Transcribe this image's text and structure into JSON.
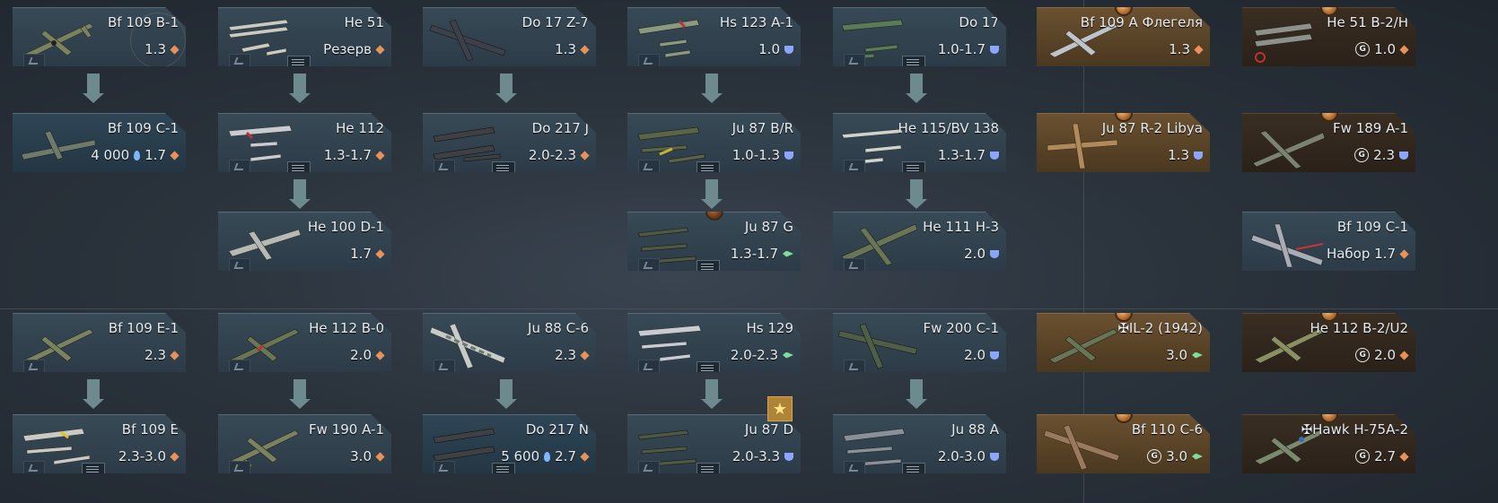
{
  "icons": {
    "fighter_color": "#e8925a",
    "bomber_color": "#8aa6ff",
    "attacker_color": "#7fdc9a"
  },
  "cards": {
    "bf109b1": {
      "name": "Bf 109 B-1",
      "br": "1.3"
    },
    "bf109c1": {
      "name": "Bf 109 C-1",
      "cost": "4 000",
      "br": "1.7"
    },
    "he51": {
      "name": "He 51",
      "br": "Резерв"
    },
    "he112": {
      "name": "He 112",
      "br": "1.3-1.7"
    },
    "he100d1": {
      "name": "He 100 D-1",
      "br": "1.7"
    },
    "do17z7": {
      "name": "Do 17 Z-7",
      "br": "1.3"
    },
    "do217j": {
      "name": "Do 217 J",
      "br": "2.0-2.3"
    },
    "hs123a1": {
      "name": "Hs 123 A-1",
      "br": "1.0"
    },
    "ju87br": {
      "name": "Ju 87 B/R",
      "br": "1.0-1.3"
    },
    "ju87g": {
      "name": "Ju 87 G",
      "br": "1.3-1.7"
    },
    "do17": {
      "name": "Do 17",
      "br": "1.0-1.7"
    },
    "he115bv138": {
      "name": "He 115/BV 138",
      "br": "1.3-1.7"
    },
    "he111h3": {
      "name": "He 111 H-3",
      "br": "2.0"
    },
    "bf109a_fleg": {
      "name": "Bf 109 A Флегеля",
      "br": "1.3"
    },
    "ju87r2libya": {
      "name": "Ju 87 R-2 Libya",
      "br": "1.3"
    },
    "he51b2h": {
      "name": "He 51 B-2/H",
      "br": "1.0"
    },
    "fw189a1": {
      "name": "Fw 189 A-1",
      "br": "2.3"
    },
    "bf109c1_set": {
      "name": "Bf 109 C-1",
      "br": "Набор 1.7"
    },
    "bf109e1": {
      "name": "Bf 109 E-1",
      "br": "2.3"
    },
    "bf109e": {
      "name": "Bf 109 E",
      "br": "2.3-3.0"
    },
    "he112b0": {
      "name": "He 112 B-0",
      "br": "2.0"
    },
    "fw190a1": {
      "name": "Fw 190 A-1",
      "br": "3.0"
    },
    "ju88c6": {
      "name": "Ju 88 C-6",
      "br": "2.3"
    },
    "do217n": {
      "name": "Do 217 N",
      "cost": "5 600",
      "br": "2.7"
    },
    "hs129": {
      "name": "Hs 129",
      "br": "2.0-2.3"
    },
    "ju87d": {
      "name": "Ju 87 D",
      "br": "2.0-3.3"
    },
    "fw200c1": {
      "name": "Fw 200 C-1",
      "br": "2.0"
    },
    "ju88a": {
      "name": "Ju 88 A",
      "br": "2.0-3.0"
    },
    "il2_1942": {
      "name": "✠IL-2 (1942)",
      "br": "3.0"
    },
    "bf110c6": {
      "name": "Bf 110 C-6",
      "br": "3.0"
    },
    "he112b2u2": {
      "name": "He 112 B-2/U2",
      "br": "2.0"
    },
    "hawk75a2": {
      "name": "✠Hawk H-75A-2",
      "br": "2.7"
    }
  },
  "ge_symbol": "G",
  "star_symbol": "★"
}
